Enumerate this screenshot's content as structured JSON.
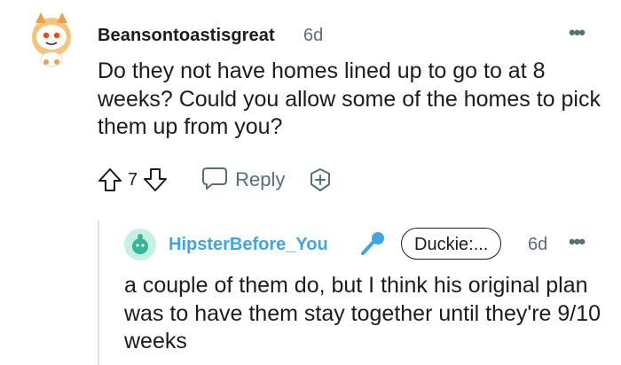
{
  "comment": {
    "username": "Beansontoastisgreat",
    "age": "6d",
    "more_icon": "•••",
    "text": "Do they not have homes lined up to go to at 8 weeks? Could you allow some of the homes to pick them up from you?",
    "score": "7",
    "reply_label": "Reply",
    "icons": {
      "avatar": "snoo-avatar-icon",
      "upvote": "arrow-up-icon",
      "downvote": "arrow-down-icon",
      "reply": "speech-bubble-icon",
      "award": "award-plus-icon"
    }
  },
  "reply": {
    "username": "HipsterBefore_You",
    "flair": "Duckie:...",
    "age": "6d",
    "more_icon": "•••",
    "text": "a couple of them do, but I think his original plan was to have them stay together until they're 9/10 weeks",
    "icons": {
      "avatar": "snoo-avatar-icon",
      "microphone": "microphone-icon"
    }
  },
  "colors": {
    "username_reply": "#3ea6e0",
    "meta": "#576f76",
    "text": "#1c1c1c",
    "thread_line": "#dfe3e5"
  }
}
